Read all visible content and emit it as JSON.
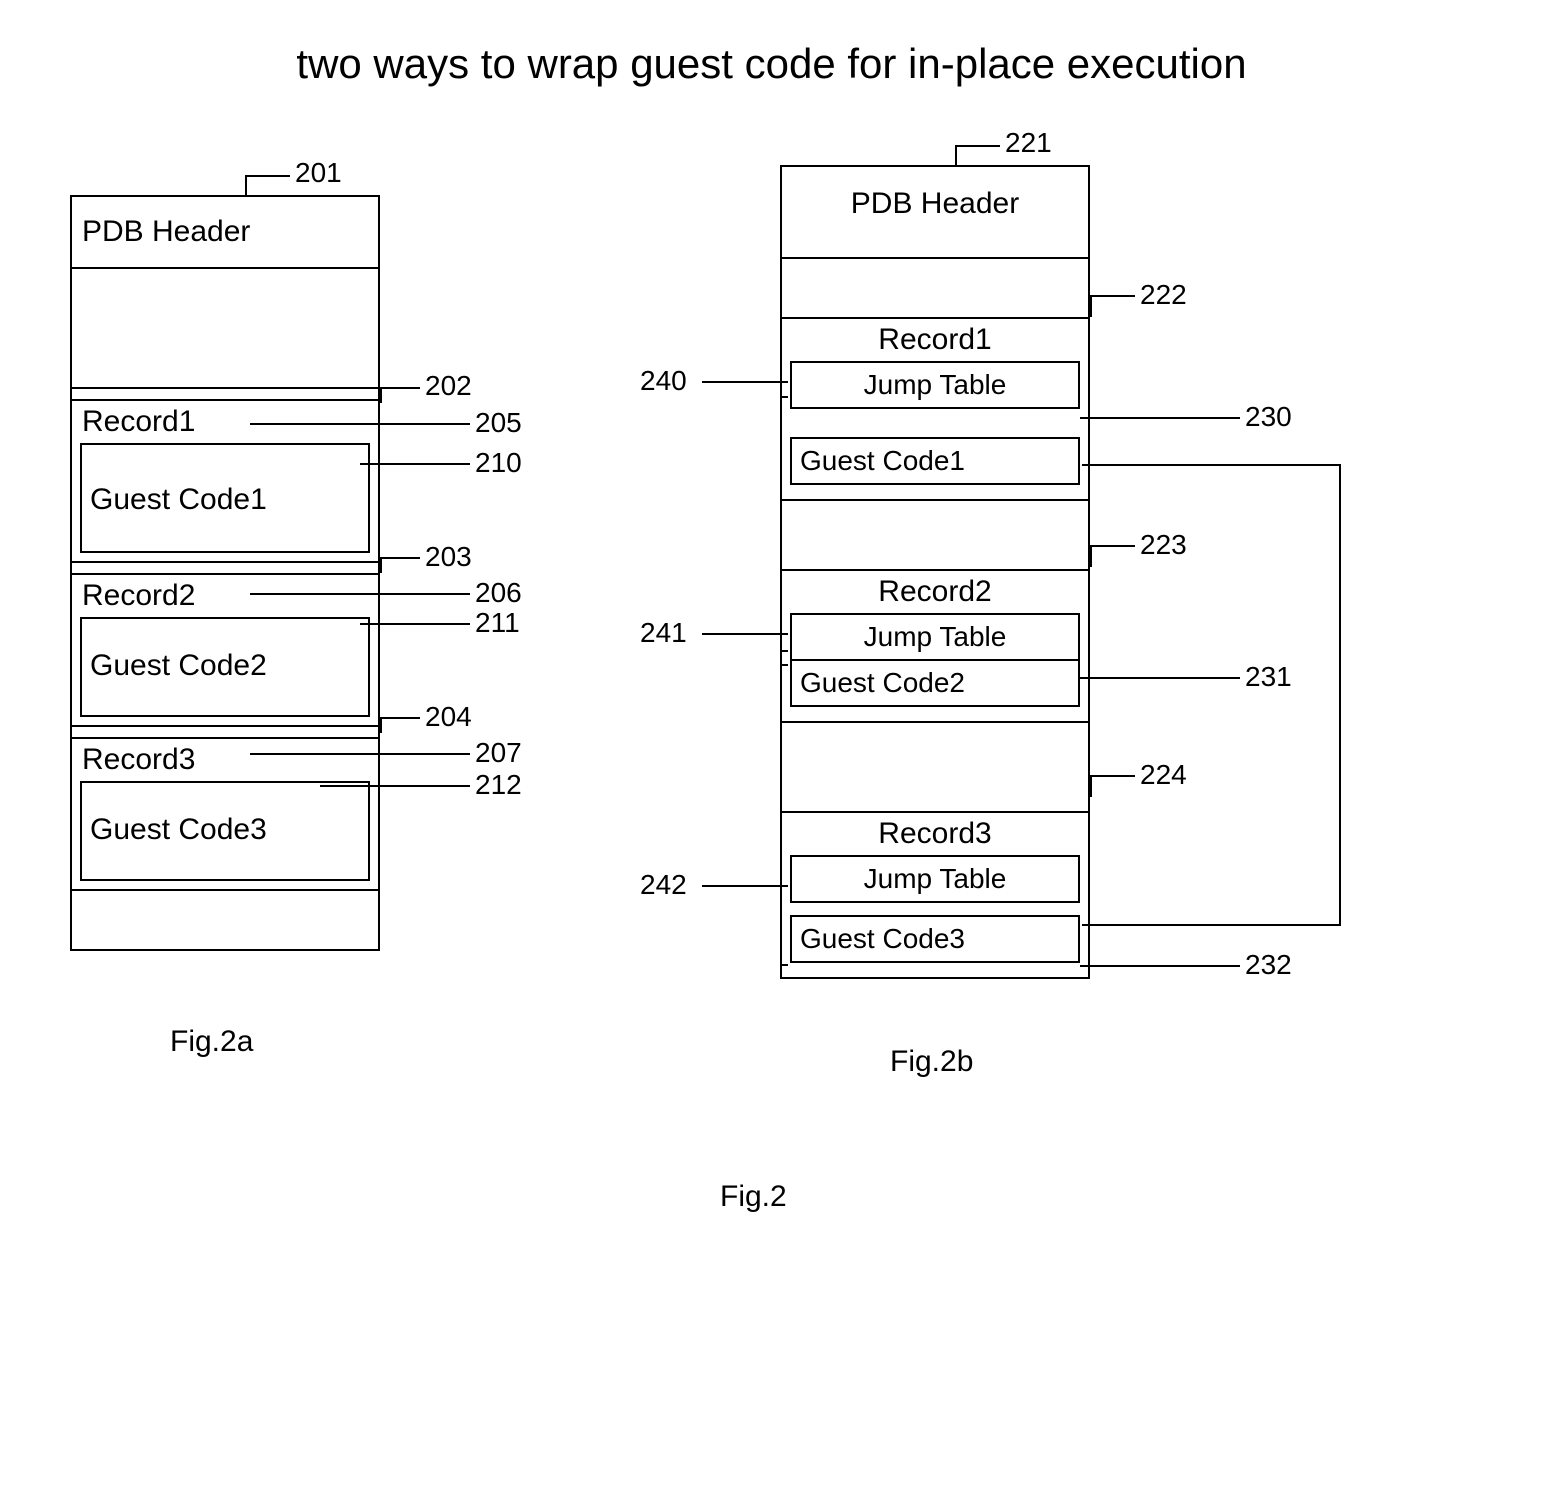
{
  "title": "two ways to wrap guest code for in-place execution",
  "figA": {
    "pdb": "PDB Header",
    "r1": "Record1",
    "g1": "Guest Code1",
    "r2": "Record2",
    "g2": "Guest Code2",
    "r3": "Record3",
    "g3": "Guest Code3",
    "caption": "Fig.2a",
    "refs": {
      "n201": "201",
      "n202": "202",
      "n205": "205",
      "n210": "210",
      "n203": "203",
      "n206": "206",
      "n211": "211",
      "n204": "204",
      "n207": "207",
      "n212": "212"
    }
  },
  "figB": {
    "pdb": "PDB Header",
    "r1": "Record1",
    "jt1": "Jump Table",
    "g1": "Guest Code1",
    "r2": "Record2",
    "jt2": "Jump Table",
    "g2": "Guest Code2",
    "r3": "Record3",
    "jt3": "Jump Table",
    "g3": "Guest Code3",
    "caption": "Fig.2b",
    "refs": {
      "n221": "221",
      "n222": "222",
      "n240": "240",
      "n230": "230",
      "n223": "223",
      "n241": "241",
      "n231": "231",
      "n224": "224",
      "n242": "242",
      "n232": "232"
    }
  },
  "mainCaption": "Fig.2"
}
